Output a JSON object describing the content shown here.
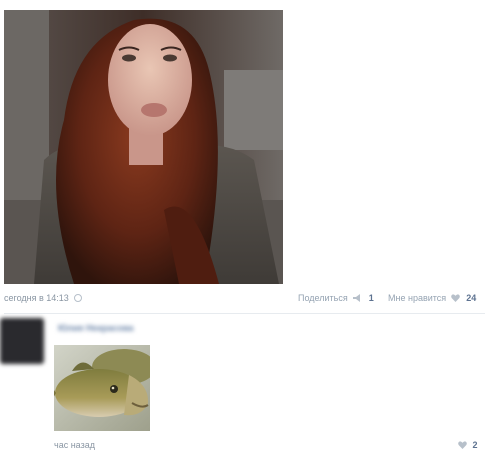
{
  "post": {
    "date": "сегодня в 14:13",
    "share_label": "Поделиться",
    "share_count": "1",
    "like_label": "Мне нравится",
    "like_count": "24"
  },
  "comment": {
    "author": "Юлия Некрасова",
    "time": "час назад",
    "like_count": "2"
  },
  "colors": {
    "link": "#5d7290",
    "muted": "#8a96a3",
    "divider": "#e7ebef"
  },
  "icons": {
    "share": "megaphone-icon",
    "like": "heart-icon",
    "date": "clock-icon"
  }
}
